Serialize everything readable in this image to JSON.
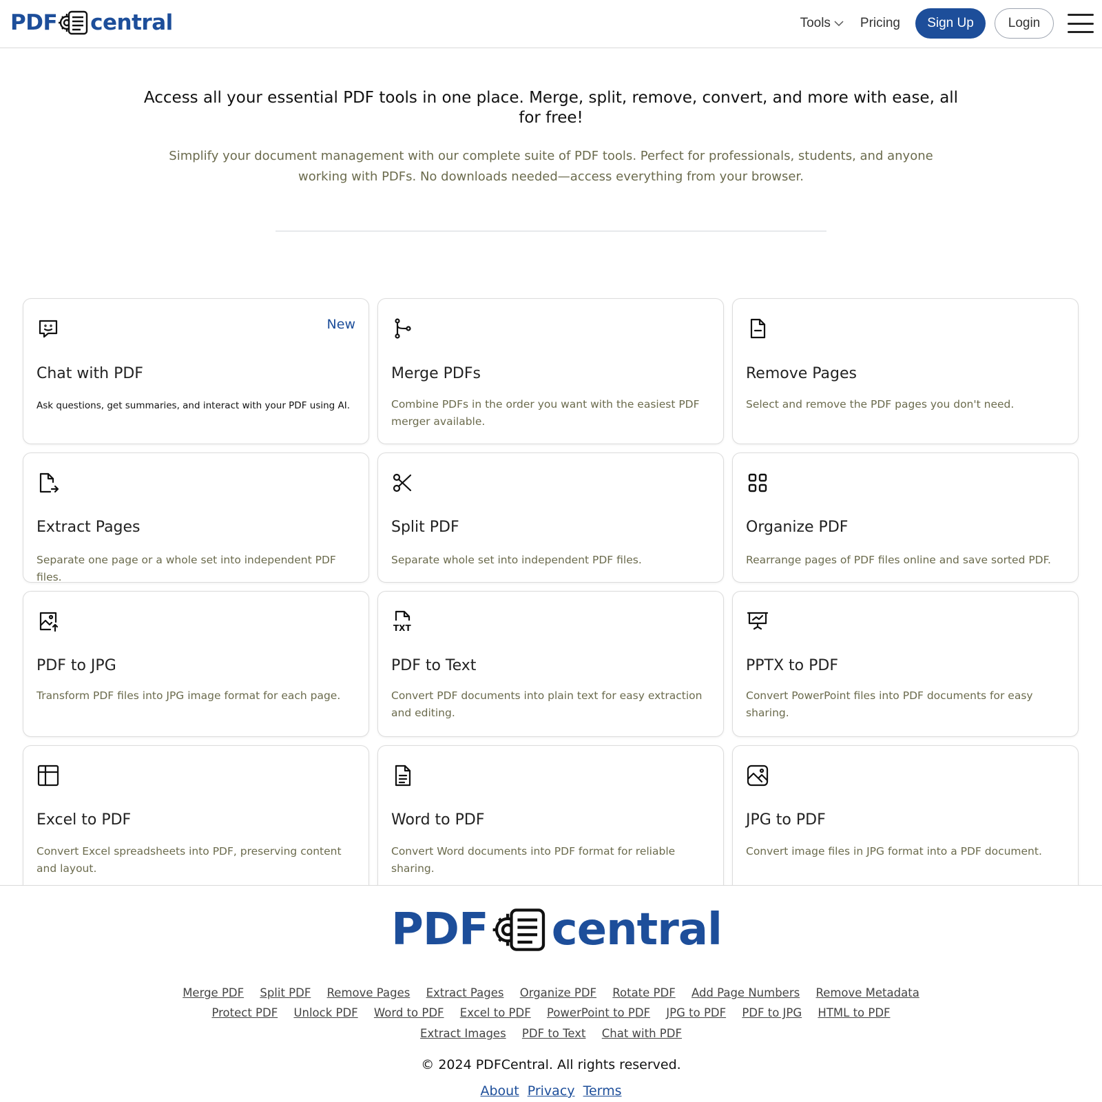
{
  "header": {
    "logo_left": "PDF",
    "logo_right": "central",
    "nav_tools": "Tools",
    "nav_pricing": "Pricing",
    "signup": "Sign Up",
    "login": "Login"
  },
  "hero": {
    "title": "Access all your essential PDF tools in one place. Merge, split, remove, convert, and more with ease, all for free!",
    "subtitle": "Simplify your document management with our complete suite of PDF tools. Perfect for professionals, students, and anyone working with PDFs. No downloads needed—access everything from your browser."
  },
  "cards": [
    {
      "icon": "chat-icon",
      "title": "Chat with PDF",
      "badge": "New",
      "desc": "Ask questions, get summaries, and interact with your PDF using AI."
    },
    {
      "icon": "merge-icon",
      "title": "Merge PDFs",
      "desc": "Combine PDFs in the order you want with the easiest PDF merger available."
    },
    {
      "icon": "remove-file-icon",
      "title": "Remove Pages",
      "desc": "Select and remove the PDF pages you don't need."
    },
    {
      "icon": "extract-file-icon",
      "title": "Extract Pages",
      "desc": "Separate one page or a whole set into independent PDF files."
    },
    {
      "icon": "scissors-icon",
      "title": "Split PDF",
      "desc": "Separate whole set into independent PDF files."
    },
    {
      "icon": "grid-icon",
      "title": "Organize PDF",
      "desc": "Rearrange pages of PDF files online and save sorted PDF."
    },
    {
      "icon": "image-upload-icon",
      "title": "PDF to JPG",
      "desc": "Transform PDF files into JPG image format for each page."
    },
    {
      "icon": "txt-file-icon",
      "title": "PDF to Text",
      "desc": "Convert PDF documents into plain text for easy extraction and editing."
    },
    {
      "icon": "presentation-icon",
      "title": "PPTX to PDF",
      "desc": "Convert PowerPoint files into PDF documents for easy sharing."
    },
    {
      "icon": "table-icon",
      "title": "Excel to PDF",
      "desc": "Convert Excel spreadsheets into PDF, preserving content and layout."
    },
    {
      "icon": "document-icon",
      "title": "Word to PDF",
      "desc": "Convert Word documents into PDF format for reliable sharing."
    },
    {
      "icon": "image-icon",
      "title": "JPG to PDF",
      "desc": "Convert image files in JPG format into a PDF document."
    }
  ],
  "footer": {
    "logo_left": "PDF",
    "logo_right": "central",
    "links_row1": [
      "Merge PDF",
      "Split PDF",
      "Remove Pages",
      "Extract Pages",
      "Organize PDF",
      "Rotate PDF",
      "Add Page Numbers",
      "Remove Metadata"
    ],
    "links_row2": [
      "Protect PDF",
      "Unlock PDF",
      "Word to PDF",
      "Excel to PDF",
      "PowerPoint to PDF",
      "JPG to PDF",
      "PDF to JPG",
      "HTML to PDF"
    ],
    "links_row3": [
      "Extract Images",
      "PDF to Text",
      "Chat with PDF"
    ],
    "copyright": "© 2024 PDFCentral. All rights reserved.",
    "bottom_links": [
      "About",
      "Privacy",
      "Terms"
    ]
  },
  "colors": {
    "brand": "#1d4e9a",
    "muted_text": "#6b6b4d"
  }
}
